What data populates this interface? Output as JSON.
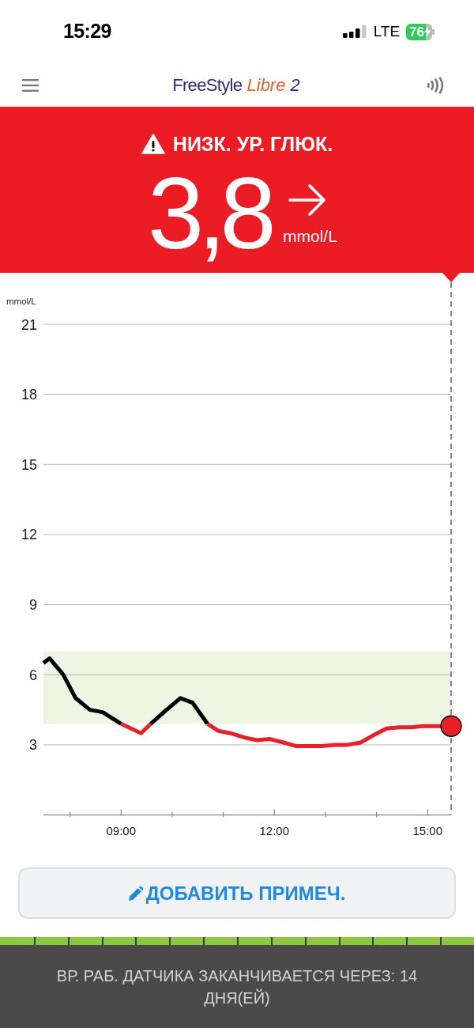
{
  "status_bar": {
    "time": "15:29",
    "network": "LTE",
    "battery": "76"
  },
  "header": {
    "logo": {
      "brand": "FreeStyle",
      "product": "Libre",
      "version": "2"
    }
  },
  "alert": {
    "kind": "low",
    "title": "НИЗК. УР. ГЛЮК.",
    "value": "3,8",
    "unit": "mmol/L"
  },
  "chart": {
    "chart_data": {
      "type": "line",
      "ylabel": "mmol/L",
      "x": [
        7.48,
        7.6,
        7.87,
        8.11,
        8.39,
        8.64,
        9.0,
        9.39,
        9.58,
        9.89,
        10.16,
        10.4,
        10.69,
        10.9,
        11.14,
        11.44,
        11.66,
        11.91,
        12.18,
        12.42,
        12.92,
        13.19,
        13.43,
        13.69,
        13.93,
        14.2,
        14.44,
        14.67,
        14.91,
        15.3,
        15.46
      ],
      "series": [
        {
          "color": "#000000",
          "values": [
            6.5,
            6.7,
            6.0,
            5.0,
            4.5,
            4.4,
            3.9,
            null,
            3.9,
            4.5,
            5.0,
            4.8,
            3.9,
            null,
            null,
            null,
            null,
            null,
            null,
            null,
            null,
            null,
            null,
            null,
            null,
            null,
            null,
            null,
            null,
            null,
            null
          ]
        },
        {
          "color": "#e8202a",
          "values": [
            null,
            null,
            null,
            null,
            null,
            null,
            3.9,
            3.5,
            3.9,
            null,
            null,
            null,
            3.9,
            3.6,
            3.5,
            3.3,
            3.2,
            3.25,
            3.1,
            2.95,
            2.95,
            3.0,
            3.0,
            3.1,
            3.4,
            3.7,
            3.75,
            3.75,
            3.8,
            3.8,
            3.8
          ]
        }
      ],
      "xlim": [
        7.48,
        15.46
      ],
      "ylim": [
        0,
        21
      ],
      "xticks": [
        {
          "value": 9,
          "label": "09:00"
        },
        {
          "value": 12,
          "label": "12:00"
        },
        {
          "value": 15,
          "label": "15:00"
        }
      ],
      "yticks": [
        3,
        6,
        9,
        12,
        15,
        18,
        21
      ],
      "grid": true,
      "bands": [
        {
          "axis": "y",
          "from": 3.9,
          "to": 7
        }
      ]
    }
  },
  "note_button": {
    "label": "ДОБАВИТЬ ПРИМЕЧ."
  },
  "sensor_life": {
    "level": 1,
    "message": "ВР. РАБ. ДАТЧИКА ЗАКАНЧИВАЕТСЯ ЧЕРЕЗ: 14 ДНЯ(ЕЙ)"
  }
}
